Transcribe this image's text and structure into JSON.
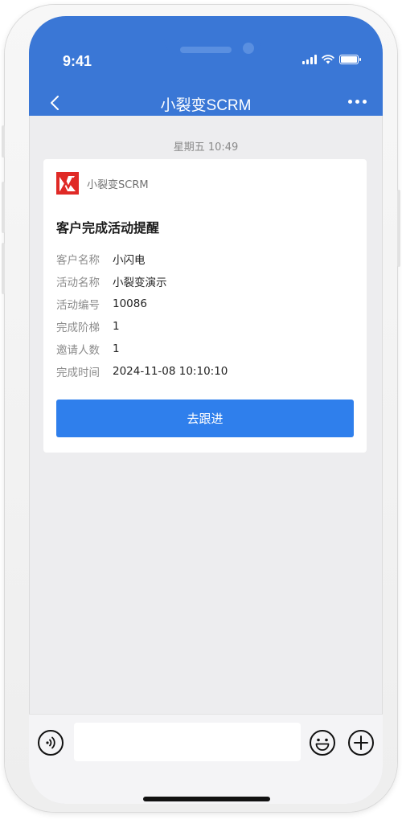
{
  "status_bar": {
    "time": "9:41"
  },
  "nav": {
    "title": "小裂变SCRM"
  },
  "chat": {
    "timestamp": "星期五 10:49"
  },
  "card": {
    "app_name": "小裂变SCRM",
    "title": "客户完成活动提醒",
    "fields": [
      {
        "label": "客户名称",
        "value": "小闪电"
      },
      {
        "label": "活动名称",
        "value": "小裂变演示"
      },
      {
        "label": "活动编号",
        "value": "10086"
      },
      {
        "label": "完成阶梯",
        "value": "1"
      },
      {
        "label": "邀请人数",
        "value": "1"
      },
      {
        "label": "完成时间",
        "value": "2024-11-08 10:10:10"
      }
    ],
    "button_label": "去跟进"
  },
  "input": {
    "value": "",
    "placeholder": ""
  },
  "colors": {
    "header": "#3a77d6",
    "button": "#2f7fec",
    "logo": "#e02a26"
  },
  "icons": [
    "back-icon",
    "more-icon",
    "signal-icon",
    "wifi-icon",
    "battery-icon",
    "voice-icon",
    "emoji-icon",
    "plus-icon"
  ]
}
